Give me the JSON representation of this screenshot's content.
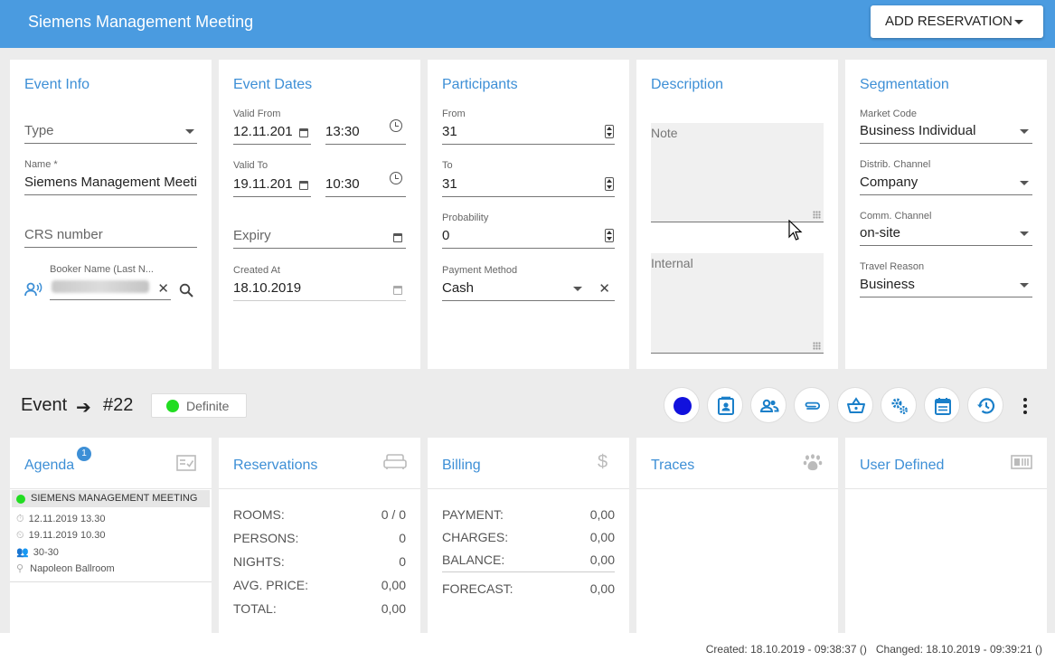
{
  "header": {
    "title": "Siemens Management Meeting",
    "add_reservation_label": "ADD RESERVATION"
  },
  "event_info": {
    "title": "Event Info",
    "type_placeholder": "Type",
    "name_label": "Name *",
    "name_value": "Siemens Management Meetin",
    "crs_placeholder": "CRS number",
    "booker_label": "Booker Name (Last N..."
  },
  "event_dates": {
    "title": "Event Dates",
    "valid_from_label": "Valid From",
    "valid_from_date": "12.11.201",
    "valid_from_time": "13:30",
    "valid_to_label": "Valid To",
    "valid_to_date": "19.11.201",
    "valid_to_time": "10:30",
    "expiry_placeholder": "Expiry",
    "created_at_label": "Created At",
    "created_at_value": "18.10.2019"
  },
  "participants": {
    "title": "Participants",
    "from_label": "From",
    "from_value": "31",
    "to_label": "To",
    "to_value": "31",
    "probability_label": "Probability",
    "probability_value": "0",
    "payment_label": "Payment Method",
    "payment_value": "Cash"
  },
  "description": {
    "title": "Description",
    "note_placeholder": "Note",
    "internal_placeholder": "Internal"
  },
  "segmentation": {
    "title": "Segmentation",
    "market_code_label": "Market Code",
    "market_code_value": "Business Individual",
    "distrib_label": "Distrib. Channel",
    "distrib_value": "Company",
    "comm_label": "Comm. Channel",
    "comm_value": "on-site",
    "travel_label": "Travel Reason",
    "travel_value": "Business"
  },
  "event_bar": {
    "label": "Event",
    "number": "#22",
    "status": "Definite",
    "status_color": "#22dd22",
    "toolbar_icons": [
      "color-dot-icon",
      "contact-card-icon",
      "people-icon",
      "paperclip-icon",
      "basket-icon",
      "gears-icon",
      "calendar-icon",
      "history-icon",
      "more-vert-icon"
    ]
  },
  "agenda": {
    "title": "Agenda",
    "badge": "1",
    "item_title": "SIEMENS MANAGEMENT MEETING",
    "start": "12.11.2019 13.30",
    "end": "19.11.2019 10.30",
    "persons": "30-30",
    "location": "Napoleon Ballroom"
  },
  "reservations": {
    "title": "Reservations",
    "rows": [
      {
        "label": "ROOMS:",
        "value": "0 / 0"
      },
      {
        "label": "PERSONS:",
        "value": "0"
      },
      {
        "label": "NIGHTS:",
        "value": "0"
      },
      {
        "label": "AVG. PRICE:",
        "value": "0,00"
      },
      {
        "label": "TOTAL:",
        "value": "0,00"
      }
    ]
  },
  "billing": {
    "title": "Billing",
    "rows": [
      {
        "label": "PAYMENT:",
        "value": "0,00"
      },
      {
        "label": "CHARGES:",
        "value": "0,00"
      },
      {
        "label": "BALANCE:",
        "value": "0,00"
      }
    ],
    "forecast_label": "FORECAST:",
    "forecast_value": "0,00"
  },
  "traces": {
    "title": "Traces"
  },
  "user_defined": {
    "title": "User Defined"
  },
  "footer": {
    "text": "Created: 18.10.2019 - 09:38:37 ()   Changed: 18.10.2019 - 09:39:21 ()"
  },
  "colors": {
    "accent": "#4a9be0",
    "title_blue": "#3d8fd6",
    "toolbar_dot": "#1111dd"
  }
}
